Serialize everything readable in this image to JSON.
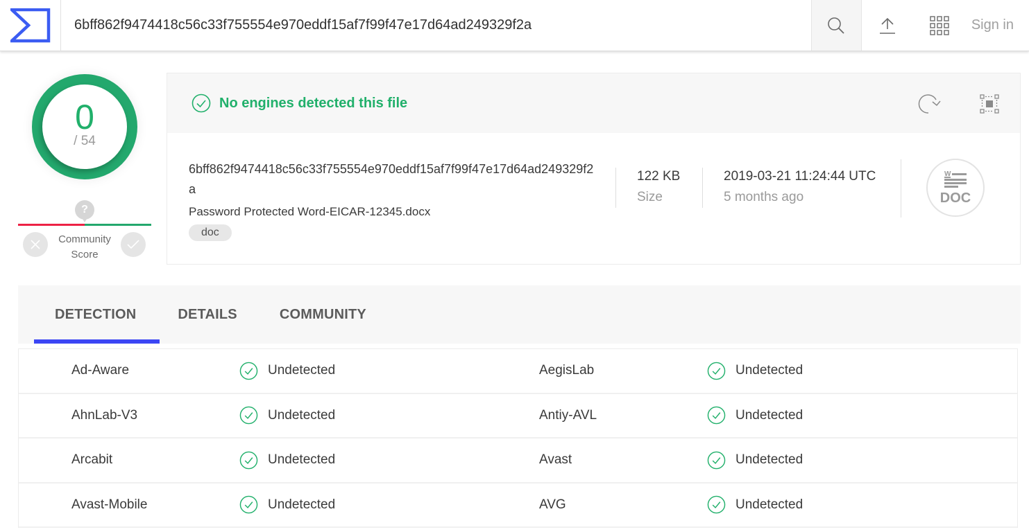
{
  "header": {
    "logo": "virustotal-logo",
    "search_value": "6bff862f9474418c56c33f755554e970eddf15af7f99f47e17d64ad249329f2a",
    "search_icon": "search-icon",
    "upload_icon": "upload-icon",
    "apps_icon": "apps-grid-icon",
    "sign_in_label": "Sign in"
  },
  "score": {
    "detected": "0",
    "total": "/ 54",
    "ring_color": "#23a86d",
    "community": {
      "label_line1": "Community",
      "label_line2": "Score",
      "marker": "?",
      "negative_color": "#ed2245",
      "positive_color": "#23a86d"
    }
  },
  "summary": {
    "status_text": "No engines detected this file",
    "status_color": "#21b06b",
    "hash": "6bff862f9474418c56c33f755554e970eddf15af7f99f47e17d64ad249329f2a",
    "filename": "Password Protected Word-EICAR-12345.docx",
    "tags": [
      "doc"
    ],
    "size_value": "122 KB",
    "size_label": "Size",
    "date_value": "2019-03-21 11:24:44 UTC",
    "date_relative": "5 months ago",
    "filetype_label": "DOC"
  },
  "tabs": [
    {
      "label": "DETECTION",
      "active": true
    },
    {
      "label": "DETAILS",
      "active": false
    },
    {
      "label": "COMMUNITY",
      "active": false
    }
  ],
  "tab_accent": "#3b46f4",
  "detections": [
    {
      "left": {
        "engine": "Ad-Aware",
        "result": "Undetected"
      },
      "right": {
        "engine": "AegisLab",
        "result": "Undetected"
      }
    },
    {
      "left": {
        "engine": "AhnLab-V3",
        "result": "Undetected"
      },
      "right": {
        "engine": "Antiy-AVL",
        "result": "Undetected"
      }
    },
    {
      "left": {
        "engine": "Arcabit",
        "result": "Undetected"
      },
      "right": {
        "engine": "Avast",
        "result": "Undetected"
      }
    },
    {
      "left": {
        "engine": "Avast-Mobile",
        "result": "Undetected"
      },
      "right": {
        "engine": "AVG",
        "result": "Undetected"
      }
    }
  ]
}
